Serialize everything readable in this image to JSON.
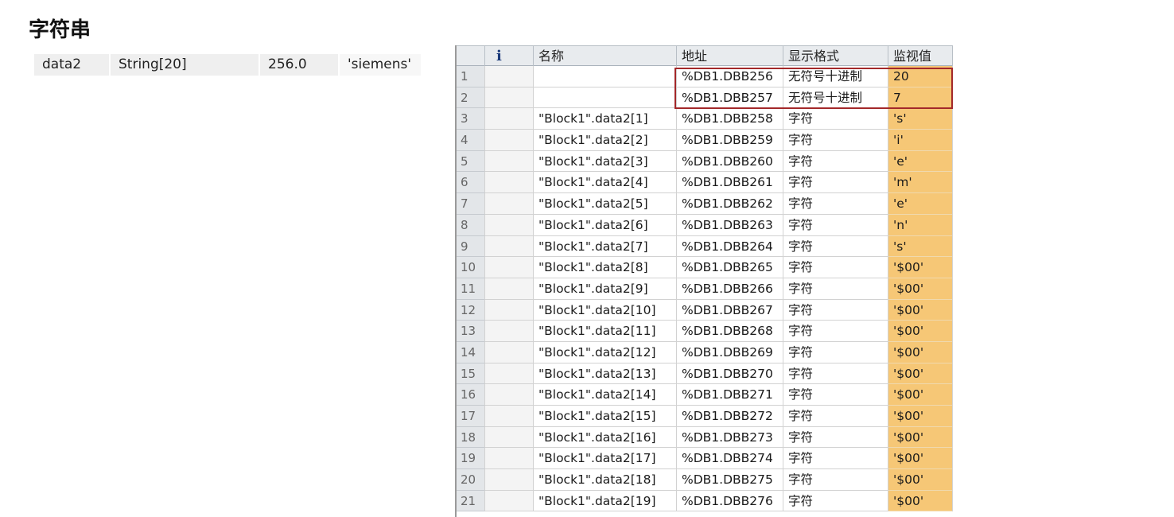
{
  "title": "字符串",
  "declaration": {
    "name": "data2",
    "type": "String[20]",
    "offset": "256.0",
    "value": "'siemens'"
  },
  "table": {
    "headers": {
      "index": "",
      "info": "i",
      "name": "名称",
      "address": "地址",
      "format": "显示格式",
      "monitor": "监视值"
    },
    "rows": [
      {
        "n": "1",
        "name": "",
        "addr": "%DB1.DBB256",
        "fmt": "无符号十进制",
        "val": "20"
      },
      {
        "n": "2",
        "name": "",
        "addr": "%DB1.DBB257",
        "fmt": "无符号十进制",
        "val": "7"
      },
      {
        "n": "3",
        "name": "\"Block1\".data2[1]",
        "addr": "%DB1.DBB258",
        "fmt": "字符",
        "val": "'s'"
      },
      {
        "n": "4",
        "name": "\"Block1\".data2[2]",
        "addr": "%DB1.DBB259",
        "fmt": "字符",
        "val": "'i'"
      },
      {
        "n": "5",
        "name": "\"Block1\".data2[3]",
        "addr": "%DB1.DBB260",
        "fmt": "字符",
        "val": "'e'"
      },
      {
        "n": "6",
        "name": "\"Block1\".data2[4]",
        "addr": "%DB1.DBB261",
        "fmt": "字符",
        "val": "'m'"
      },
      {
        "n": "7",
        "name": "\"Block1\".data2[5]",
        "addr": "%DB1.DBB262",
        "fmt": "字符",
        "val": "'e'"
      },
      {
        "n": "8",
        "name": "\"Block1\".data2[6]",
        "addr": "%DB1.DBB263",
        "fmt": "字符",
        "val": "'n'"
      },
      {
        "n": "9",
        "name": "\"Block1\".data2[7]",
        "addr": "%DB1.DBB264",
        "fmt": "字符",
        "val": "'s'"
      },
      {
        "n": "10",
        "name": "\"Block1\".data2[8]",
        "addr": "%DB1.DBB265",
        "fmt": "字符",
        "val": "'$00'"
      },
      {
        "n": "11",
        "name": "\"Block1\".data2[9]",
        "addr": "%DB1.DBB266",
        "fmt": "字符",
        "val": "'$00'"
      },
      {
        "n": "12",
        "name": "\"Block1\".data2[10]",
        "addr": "%DB1.DBB267",
        "fmt": "字符",
        "val": "'$00'"
      },
      {
        "n": "13",
        "name": "\"Block1\".data2[11]",
        "addr": "%DB1.DBB268",
        "fmt": "字符",
        "val": "'$00'"
      },
      {
        "n": "14",
        "name": "\"Block1\".data2[12]",
        "addr": "%DB1.DBB269",
        "fmt": "字符",
        "val": "'$00'"
      },
      {
        "n": "15",
        "name": "\"Block1\".data2[13]",
        "addr": "%DB1.DBB270",
        "fmt": "字符",
        "val": "'$00'"
      },
      {
        "n": "16",
        "name": "\"Block1\".data2[14]",
        "addr": "%DB1.DBB271",
        "fmt": "字符",
        "val": "'$00'"
      },
      {
        "n": "17",
        "name": "\"Block1\".data2[15]",
        "addr": "%DB1.DBB272",
        "fmt": "字符",
        "val": "'$00'"
      },
      {
        "n": "18",
        "name": "\"Block1\".data2[16]",
        "addr": "%DB1.DBB273",
        "fmt": "字符",
        "val": "'$00'"
      },
      {
        "n": "19",
        "name": "\"Block1\".data2[17]",
        "addr": "%DB1.DBB274",
        "fmt": "字符",
        "val": "'$00'"
      },
      {
        "n": "20",
        "name": "\"Block1\".data2[18]",
        "addr": "%DB1.DBB275",
        "fmt": "字符",
        "val": "'$00'"
      },
      {
        "n": "21",
        "name": "\"Block1\".data2[19]",
        "addr": "%DB1.DBB276",
        "fmt": "字符",
        "val": "'$00'"
      }
    ]
  },
  "colors": {
    "monitor_value_bg": "#f6c776",
    "highlight_border": "#a3282a",
    "info_icon": "#1b3a7a"
  }
}
